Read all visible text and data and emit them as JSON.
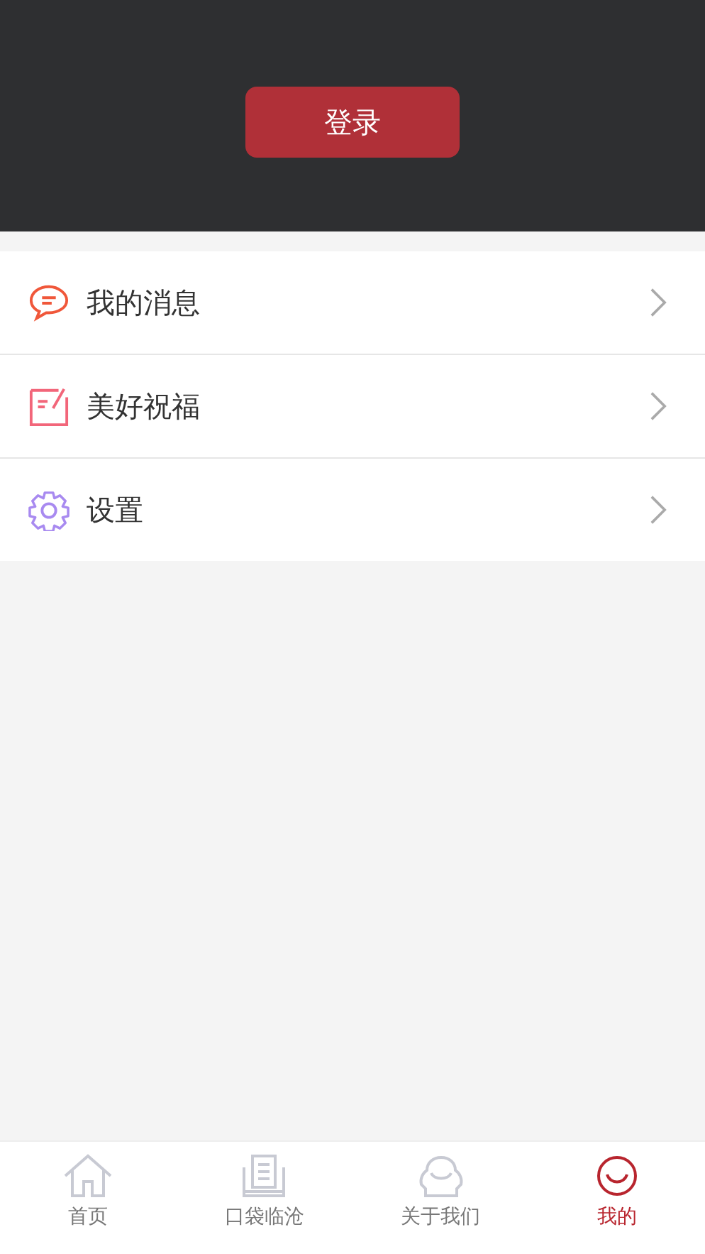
{
  "header": {
    "login_button": "登录"
  },
  "menu": [
    {
      "kind": "message",
      "label": "我的消息"
    },
    {
      "kind": "blessing",
      "label": "美好祝福"
    },
    {
      "kind": "settings",
      "label": "设置"
    }
  ],
  "tab_bar": [
    {
      "kind": "home",
      "label": "首页",
      "selected": false
    },
    {
      "kind": "book",
      "label": "口袋临沧",
      "selected": false
    },
    {
      "kind": "people",
      "label": "关于我们",
      "selected": false
    },
    {
      "kind": "smile",
      "label": "我的",
      "selected": true
    }
  ]
}
